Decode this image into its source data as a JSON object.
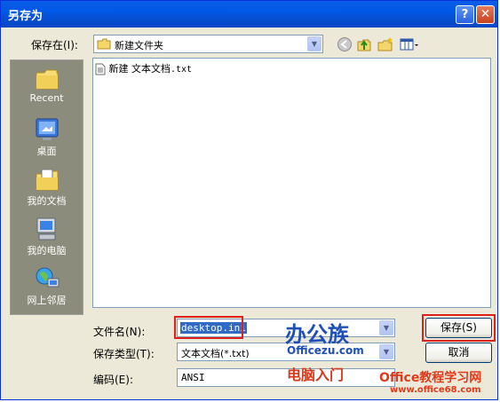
{
  "window": {
    "title": "另存为"
  },
  "save_in": {
    "label": "保存在(I):",
    "value": "新建文件夹"
  },
  "places": [
    {
      "label": "Recent"
    },
    {
      "label": "桌面"
    },
    {
      "label": "我的文档"
    },
    {
      "label": "我的电脑"
    },
    {
      "label": "网上邻居"
    }
  ],
  "files": [
    {
      "name": "新建 文本文档",
      "ext": ".txt"
    }
  ],
  "filename": {
    "label": "文件名(N):",
    "value": "desktop.ini"
  },
  "filetype": {
    "label": "保存类型(T):",
    "value": "文本文档(*.txt)"
  },
  "encoding": {
    "label": "编码(E):",
    "value": "ANSI"
  },
  "buttons": {
    "save": "保存(S)",
    "cancel": "取消"
  },
  "watermarks": {
    "brand1": "办公族",
    "brand1_url": "Officezu.com",
    "brand1_sub": "电脑入门",
    "brand2": "Office教程学习网",
    "brand2_url": "www.office68.com"
  },
  "colors": {
    "titlebar": "#0058e6",
    "highlight": "#316ac5",
    "callout": "#e0201b"
  }
}
